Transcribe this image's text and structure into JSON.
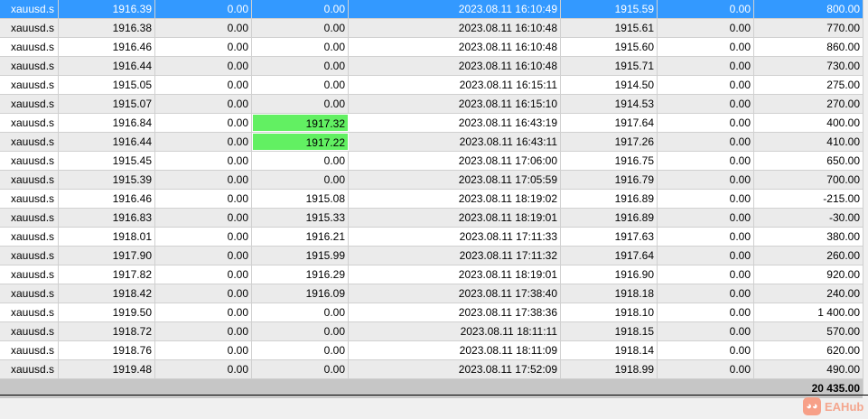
{
  "rows": [
    [
      "xauusd.s",
      "1916.39",
      "0.00",
      "0.00",
      "2023.08.11 16:10:49",
      "1915.59",
      "0.00",
      "800.00"
    ],
    [
      "xauusd.s",
      "1916.38",
      "0.00",
      "0.00",
      "2023.08.11 16:10:48",
      "1915.61",
      "0.00",
      "770.00"
    ],
    [
      "xauusd.s",
      "1916.46",
      "0.00",
      "0.00",
      "2023.08.11 16:10:48",
      "1915.60",
      "0.00",
      "860.00"
    ],
    [
      "xauusd.s",
      "1916.44",
      "0.00",
      "0.00",
      "2023.08.11 16:10:48",
      "1915.71",
      "0.00",
      "730.00"
    ],
    [
      "xauusd.s",
      "1915.05",
      "0.00",
      "0.00",
      "2023.08.11 16:15:11",
      "1914.50",
      "0.00",
      "275.00"
    ],
    [
      "xauusd.s",
      "1915.07",
      "0.00",
      "0.00",
      "2023.08.11 16:15:10",
      "1914.53",
      "0.00",
      "270.00"
    ],
    [
      "xauusd.s",
      "1916.84",
      "0.00",
      "1917.32",
      "2023.08.11 16:43:19",
      "1917.64",
      "0.00",
      "400.00"
    ],
    [
      "xauusd.s",
      "1916.44",
      "0.00",
      "1917.22",
      "2023.08.11 16:43:11",
      "1917.26",
      "0.00",
      "410.00"
    ],
    [
      "xauusd.s",
      "1915.45",
      "0.00",
      "0.00",
      "2023.08.11 17:06:00",
      "1916.75",
      "0.00",
      "650.00"
    ],
    [
      "xauusd.s",
      "1915.39",
      "0.00",
      "0.00",
      "2023.08.11 17:05:59",
      "1916.79",
      "0.00",
      "700.00"
    ],
    [
      "xauusd.s",
      "1916.46",
      "0.00",
      "1915.08",
      "2023.08.11 18:19:02",
      "1916.89",
      "0.00",
      "-215.00"
    ],
    [
      "xauusd.s",
      "1916.83",
      "0.00",
      "1915.33",
      "2023.08.11 18:19:01",
      "1916.89",
      "0.00",
      "-30.00"
    ],
    [
      "xauusd.s",
      "1918.01",
      "0.00",
      "1916.21",
      "2023.08.11 17:11:33",
      "1917.63",
      "0.00",
      "380.00"
    ],
    [
      "xauusd.s",
      "1917.90",
      "0.00",
      "1915.99",
      "2023.08.11 17:11:32",
      "1917.64",
      "0.00",
      "260.00"
    ],
    [
      "xauusd.s",
      "1917.82",
      "0.00",
      "1916.29",
      "2023.08.11 18:19:01",
      "1916.90",
      "0.00",
      "920.00"
    ],
    [
      "xauusd.s",
      "1918.42",
      "0.00",
      "1916.09",
      "2023.08.11 17:38:40",
      "1918.18",
      "0.00",
      "240.00"
    ],
    [
      "xauusd.s",
      "1919.50",
      "0.00",
      "0.00",
      "2023.08.11 17:38:36",
      "1918.10",
      "0.00",
      "1 400.00"
    ],
    [
      "xauusd.s",
      "1918.72",
      "0.00",
      "0.00",
      "2023.08.11 18:11:11",
      "1918.15",
      "0.00",
      "570.00"
    ],
    [
      "xauusd.s",
      "1918.76",
      "0.00",
      "0.00",
      "2023.08.11 18:11:09",
      "1918.14",
      "0.00",
      "620.00"
    ],
    [
      "xauusd.s",
      "1919.48",
      "0.00",
      "0.00",
      "2023.08.11 17:52:09",
      "1918.99",
      "0.00",
      "490.00"
    ]
  ],
  "highlighted_rows": [
    6,
    7
  ],
  "selected_row": 0,
  "total": "20 435.00",
  "watermark": "EAHub",
  "colors": {
    "selected": "#3399ff",
    "highlight": "#62f062"
  }
}
